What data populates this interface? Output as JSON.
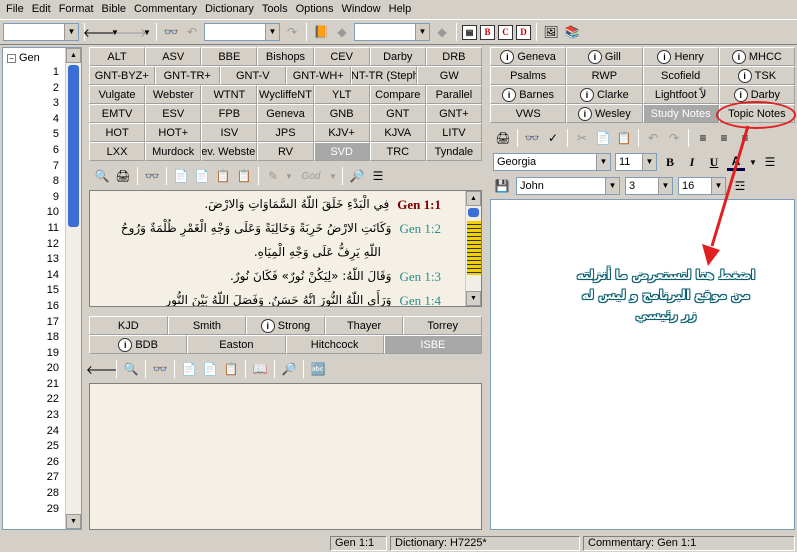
{
  "menu": [
    "File",
    "Edit",
    "Format",
    "Bible",
    "Commentary",
    "Dictionary",
    "Tools",
    "Options",
    "Window",
    "Help"
  ],
  "toolbar": {
    "rtf_buttons": [
      "B",
      "C",
      "D"
    ]
  },
  "tree": {
    "root": "Gen",
    "chapters": [
      "1",
      "2",
      "3",
      "4",
      "5",
      "6",
      "7",
      "8",
      "9",
      "10",
      "11",
      "12",
      "13",
      "14",
      "15",
      "16",
      "17",
      "18",
      "19",
      "20",
      "21",
      "22",
      "23",
      "24",
      "25",
      "26",
      "27",
      "28",
      "29"
    ]
  },
  "bible_tabs": [
    [
      "ALT",
      "ASV",
      "BBE",
      "Bishops",
      "CEV",
      "Darby",
      "DRB"
    ],
    [
      "GNT-BYZ+",
      "GNT-TR+",
      "GNT-V",
      "GNT-WH+",
      "G-NT-TR (Steph)+",
      "GW"
    ],
    [
      "Vulgate",
      "Webster",
      "WTNT",
      "WycliffeNT",
      "YLT",
      "Compare",
      "Parallel"
    ],
    [
      "EMTV",
      "ESV",
      "FPB",
      "Geneva",
      "GNB",
      "GNT",
      "GNT+"
    ],
    [
      "HOT",
      "HOT+",
      "ISV",
      "JPS",
      "KJV+",
      "KJVA",
      "LITV"
    ],
    [
      "LXX",
      "Murdock",
      "Rev. Webster+",
      "RV",
      "SVD",
      "TRC",
      "Tyndale"
    ]
  ],
  "bible_selected": "SVD",
  "bible_toolbar": {
    "combo_value": "God"
  },
  "verses": [
    {
      "ref": "Gen 1:1",
      "text": "فِي الْبَدْءِ خَلَقَ اللّهُ السَّمَاوَاتِ وَالارْضَ.",
      "current": true
    },
    {
      "ref": "Gen 1:2",
      "text": "وَكَانَتِ الارْضُ خَرِبَةً وَخَالِيَةً وَعَلَى وَجْهِ الْغَمْرِ ظُلْمَةٌ وَرُوحُ",
      "current": false
    },
    {
      "ref": "",
      "text": "اللّهِ يَرِفُّ عَلَى وَجْهِ الْمِيَاهِ.",
      "current": false
    },
    {
      "ref": "Gen 1:3",
      "text": "وَقَالَ اللّهُ: «لِيَكُنْ نُورٌ» فَكَانَ نُورٌ.",
      "current": false
    },
    {
      "ref": "Gen 1:4",
      "text": "وَرَأَى اللّهُ النُّورَ انَّهُ حَسَنٌ. وَفَصَلَ اللّهُ بَيْنَ النُّورِ",
      "current": false
    }
  ],
  "dict_tabs": [
    [
      "KJD",
      "Smith",
      "Strong",
      "Thayer",
      "Torrey"
    ],
    [
      "BDB",
      "Easton",
      "Hitchcock",
      "ISBE"
    ]
  ],
  "dict_selected": "ISBE",
  "comm_tabs": [
    [
      "Geneva",
      "Gill",
      "Henry",
      "MHCC"
    ],
    [
      "Psalms",
      "RWP",
      "Scofield",
      "TSK"
    ],
    [
      "Barnes",
      "Clarke",
      "Lightfoot لاً",
      "Darby"
    ],
    [
      "VWS",
      "Wesley",
      "Study Notes",
      "Topic Notes"
    ]
  ],
  "comm_selected": "Study Notes",
  "notes_format": {
    "font": "Georgia",
    "size": "11",
    "bold": "B",
    "italic": "I",
    "underline": "U",
    "color_letter": "A"
  },
  "notes_bar": {
    "book": "John",
    "chapter": "3",
    "verse": "16"
  },
  "annotation": {
    "text": "اضغط هنا لتستعرض ما أنزلته من موقع البرنامج و ليس له زر رئيسي",
    "color": "#e02020"
  },
  "status": {
    "verse": "Gen 1:1",
    "dictionary": "Dictionary: H7225*",
    "commentary": "Commentary: Gen 1:1"
  }
}
